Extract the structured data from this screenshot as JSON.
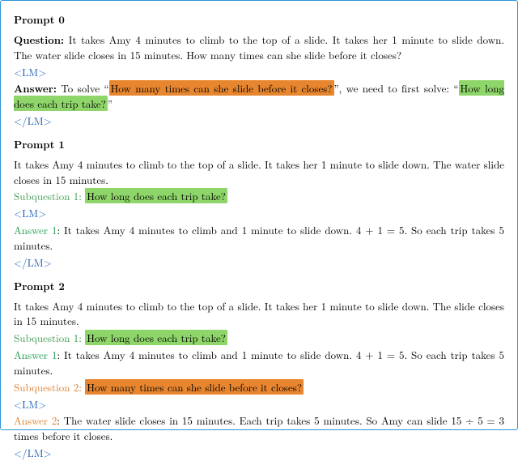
{
  "prompt0": {
    "title": "Prompt 0",
    "question_label": "Question:",
    "question_text": "It takes Amy 4 minutes to climb to the top of a slide.  It takes her 1 minute to slide down. The water slide closes in 15 minutes. How many times can she slide before it closes?",
    "lm_open": "<LM>",
    "answer_label": "Answer:",
    "answer_prefix": "To solve “",
    "answer_hl1": "How many times can she slide before it closes?",
    "answer_mid": "”, we need to first solve: “",
    "answer_hl2": "How long does each trip take?",
    "answer_suffix": "”",
    "lm_close": "</LM>"
  },
  "prompt1": {
    "title": "Prompt 1",
    "context": "It takes Amy 4 minutes to climb to the top of a slide.  It takes her 1 minute to slide down. The water slide closes in 15 minutes.",
    "subq1_label": "Subquestion 1:",
    "subq1_text": "How long does each trip take?",
    "lm_open": "<LM>",
    "ans1_label": "Answer 1",
    "ans1_text": ": It takes Amy 4 minutes to climb and 1 minute to slide down. 4 + 1 = 5. So each trip takes 5 minutes.",
    "lm_close": "</LM>"
  },
  "prompt2": {
    "title": "Prompt 2",
    "context": "It takes Amy 4 minutes to climb to the top of a slide.  It takes her 1 minute to slide down. The slide closes in 15 minutes.",
    "subq1_label": "Subquestion 1:",
    "subq1_text": "How long does each trip take?",
    "ans1_label": "Answer 1",
    "ans1_text": ": It takes Amy 4 minutes to climb and 1 minute to slide down. 4 + 1 = 5. So each trip takes 5 minutes.",
    "subq2_label": "Subquestion 2:",
    "subq2_text": "How many times can she slide before it closes?",
    "lm_open": "<LM>",
    "ans2_label": "Answer 2",
    "ans2_text": ": The water slide closes in 15 minutes. Each trip takes 5 minutes. So Amy can slide 15 ÷ 5 = 3 times before it closes.",
    "lm_close": "</LM>"
  }
}
